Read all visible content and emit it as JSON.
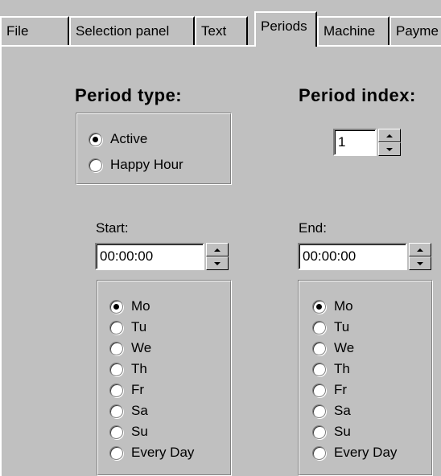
{
  "tabs": [
    {
      "label": "File",
      "active": false
    },
    {
      "label": "Selection panel",
      "active": false
    },
    {
      "label": "Text",
      "active": false
    },
    {
      "label": "Periods",
      "active": true
    },
    {
      "label": "Machine",
      "active": false
    },
    {
      "label": "Payme",
      "active": false
    }
  ],
  "period_type": {
    "heading": "Period type:",
    "options": [
      {
        "label": "Active",
        "checked": true
      },
      {
        "label": "Happy Hour",
        "checked": false
      }
    ]
  },
  "period_index": {
    "heading": "Period index:",
    "value": "1"
  },
  "start": {
    "label": "Start:",
    "value": "00:00:00",
    "days": [
      {
        "label": "Mo",
        "checked": true
      },
      {
        "label": "Tu",
        "checked": false
      },
      {
        "label": "We",
        "checked": false
      },
      {
        "label": "Th",
        "checked": false
      },
      {
        "label": "Fr",
        "checked": false
      },
      {
        "label": "Sa",
        "checked": false
      },
      {
        "label": "Su",
        "checked": false
      },
      {
        "label": "Every Day",
        "checked": false
      }
    ]
  },
  "end": {
    "label": "End:",
    "value": "00:00:00",
    "days": [
      {
        "label": "Mo",
        "checked": true
      },
      {
        "label": "Tu",
        "checked": false
      },
      {
        "label": "We",
        "checked": false
      },
      {
        "label": "Th",
        "checked": false
      },
      {
        "label": "Fr",
        "checked": false
      },
      {
        "label": "Sa",
        "checked": false
      },
      {
        "label": "Su",
        "checked": false
      },
      {
        "label": "Every Day",
        "checked": false
      }
    ]
  }
}
